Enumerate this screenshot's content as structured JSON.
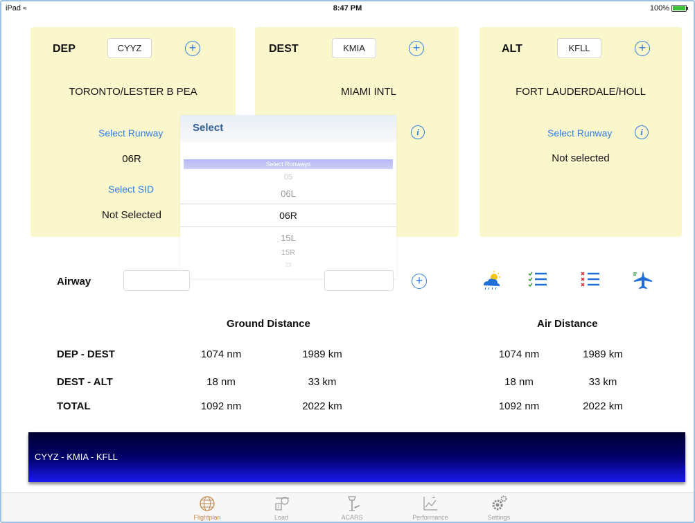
{
  "status_bar": {
    "device": "iPad",
    "time": "8:47 PM",
    "battery": "100%",
    "battery_level": 1.0
  },
  "cards": {
    "dep": {
      "label": "DEP",
      "code": "CYYZ",
      "name": "TORONTO/LESTER B PEA",
      "runway_link": "Select Runway",
      "runway_value": "06R",
      "sid_link": "Select SID",
      "sid_value": "Not Selected"
    },
    "dest": {
      "label": "DEST",
      "code": "KMIA",
      "name": "MIAMI INTL"
    },
    "alt": {
      "label": "ALT",
      "code": "KFLL",
      "name": "FORT LAUDERDALE/HOLL",
      "runway_link": "Select Runway",
      "runway_value": "Not selected"
    }
  },
  "picker": {
    "title": "Select",
    "subtitle": "Select Runways",
    "options": [
      "05",
      "06L",
      "06R",
      "15L",
      "15R",
      "23"
    ],
    "selected": "06R"
  },
  "airway": {
    "label": "Airway",
    "value": "",
    "value2": ""
  },
  "distances": {
    "ground_header": "Ground Distance",
    "air_header": "Air Distance",
    "rows": [
      {
        "label": "DEP - DEST",
        "ground_nm": "1074 nm",
        "ground_km": "1989 km",
        "air_nm": "1074 nm",
        "air_km": "1989 km"
      },
      {
        "label": "DEST - ALT",
        "ground_nm": "18 nm",
        "ground_km": "33 km",
        "air_nm": "18 nm",
        "air_km": "33 km"
      },
      {
        "label": "TOTAL",
        "ground_nm": "1092 nm",
        "ground_km": "2022 km",
        "air_nm": "1092 nm",
        "air_km": "2022 km"
      }
    ]
  },
  "route": "CYYZ - KMIA - KFLL",
  "tabs": [
    {
      "label": "Flightplan",
      "icon": "globe-icon",
      "active": true
    },
    {
      "label": "Load",
      "icon": "load-icon",
      "active": false
    },
    {
      "label": "ACARS",
      "icon": "tower-icon",
      "active": false
    },
    {
      "label": "Performance",
      "icon": "chart-icon",
      "active": false
    },
    {
      "label": "Settings",
      "icon": "gear-icon",
      "active": false
    }
  ],
  "colors": {
    "card_bg": "#fbf7cd",
    "link": "#2f7ee0",
    "tab_active": "#c48a4a",
    "banner_top": "#000030",
    "banner_bottom": "#1a1af0"
  }
}
